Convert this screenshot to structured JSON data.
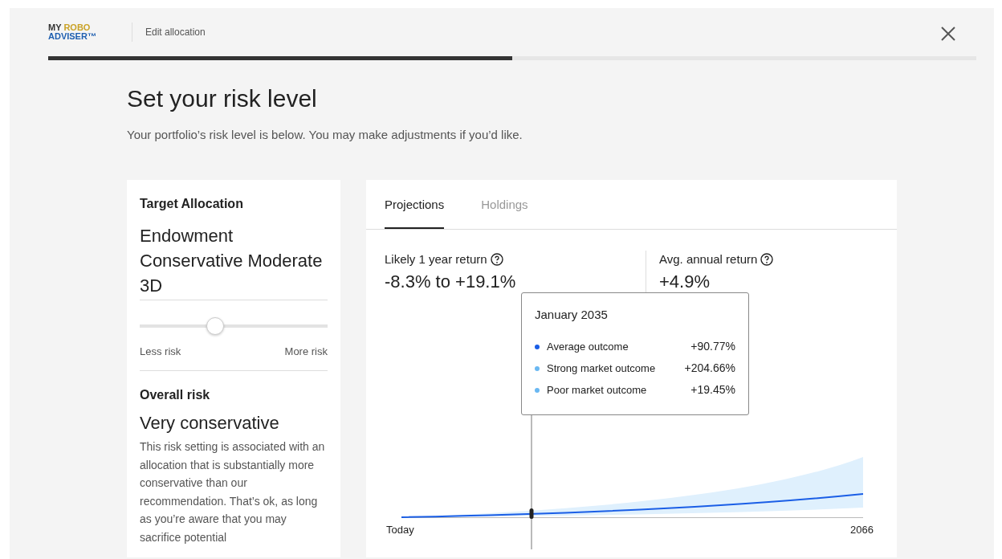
{
  "header": {
    "logo": {
      "line_1a": "MY",
      "line_1b": "ROBO",
      "line_2": "ADVISER™"
    },
    "title": "Edit allocation",
    "progress": {
      "level": 0.5
    }
  },
  "heading": "Set your risk level",
  "subheading": "Your portfolio’s risk level is below. You may make adjustments if you’d like.",
  "allocation": {
    "label": "Target Allocation",
    "name": "Endowment Conservative Moderate 3D",
    "slider": {
      "level": 0.4,
      "min_label": "Less risk",
      "max_label": "More risk"
    },
    "risk_label": "Overall risk",
    "risk_value": "Very conservative",
    "description": "This risk setting is associated with an allocation that is substantially more conservative than our recommendation. That’s ok, as long as you’re aware that you may sacrifice potential"
  },
  "tabs": [
    {
      "label": "Projections",
      "selected": true
    },
    {
      "label": "Holdings",
      "selected": false
    }
  ],
  "stats": [
    {
      "label": "Likely 1 year return",
      "value": "-8.3% to +19.1%"
    },
    {
      "label": "Avg. annual return",
      "value": "+4.9%"
    }
  ],
  "tooltip": {
    "title": "January 2035",
    "rows": [
      {
        "label": "Average outcome",
        "value": "+90.77%",
        "color": "#1a5ee6"
      },
      {
        "label": "Strong market outcome",
        "value": "+204.66%",
        "color": "#6ab8f2"
      },
      {
        "label": "Poor market outcome",
        "value": "+19.45%",
        "color": "#6ab8f2"
      }
    ]
  },
  "chart": {
    "start_label": "Today",
    "end_label": "2066"
  }
}
